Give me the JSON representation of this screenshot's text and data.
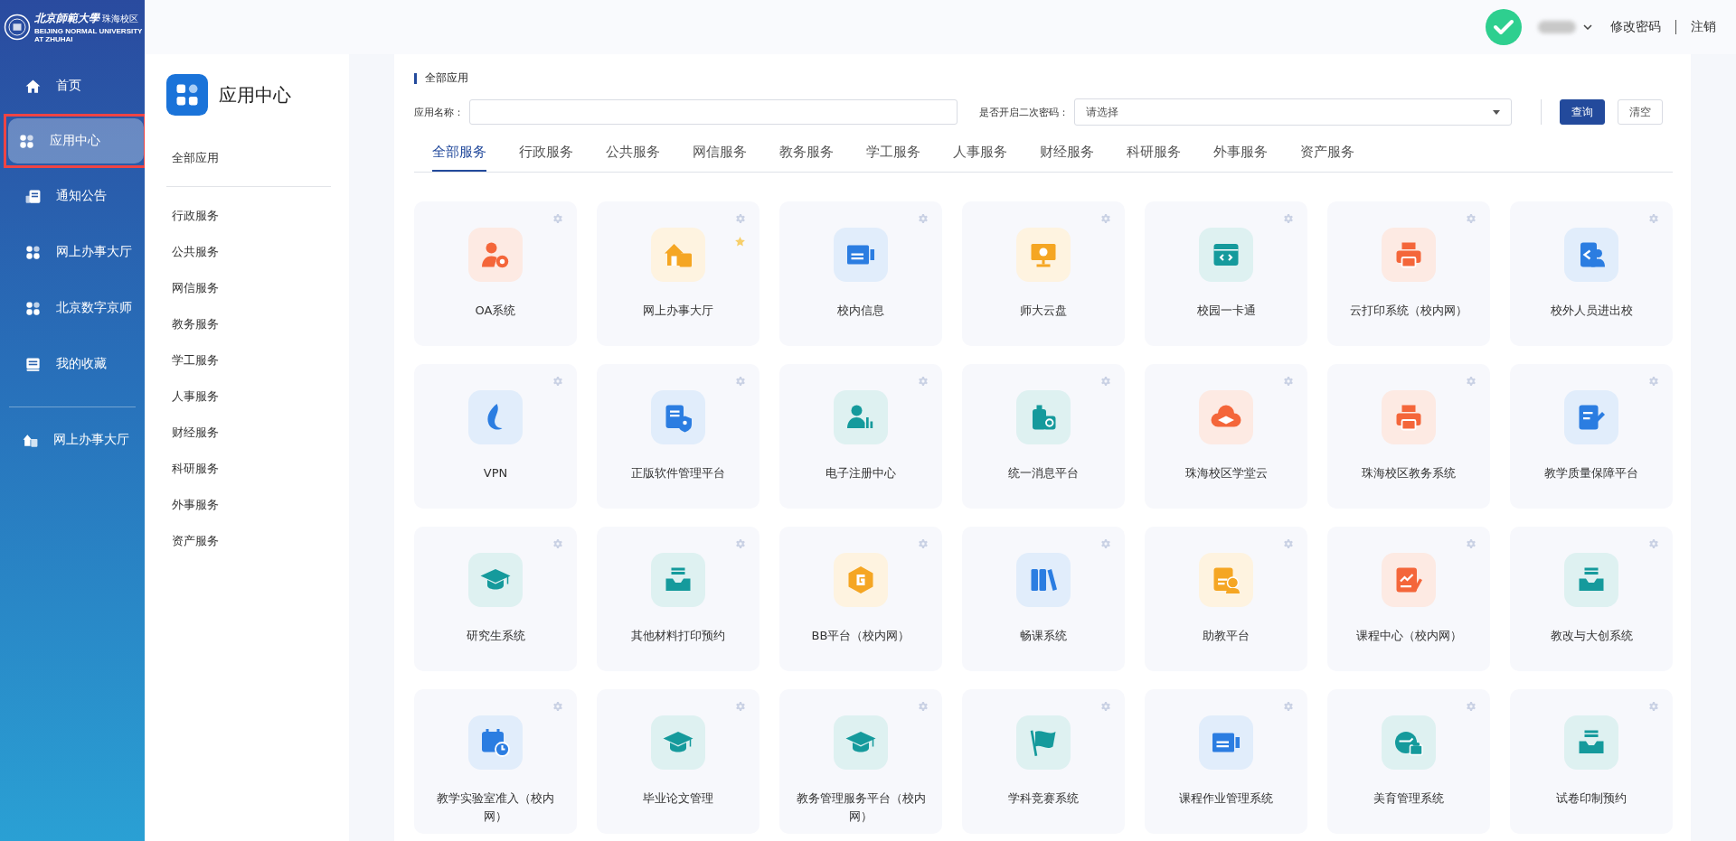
{
  "logo": {
    "name": "北京師範大學",
    "campus": "珠海校区",
    "english": "BEIJING NORMAL UNIVERSITY AT ZHUHAI"
  },
  "nav": [
    {
      "label": "首页",
      "selected": false,
      "highlighted": false
    },
    {
      "label": "应用中心",
      "selected": true,
      "highlighted": true
    },
    {
      "label": "通知公告",
      "selected": false,
      "highlighted": false
    },
    {
      "label": "网上办事大厅",
      "selected": false,
      "highlighted": false
    },
    {
      "label": "北京数字京师",
      "selected": false,
      "highlighted": false
    },
    {
      "label": "我的收藏",
      "selected": false,
      "highlighted": false
    }
  ],
  "nav_extra": [
    {
      "label": "网上办事大厅"
    }
  ],
  "header": {
    "links": [
      "修改密码",
      "注销"
    ]
  },
  "panel": {
    "title": "应用中心",
    "all": "全部应用",
    "categories": [
      "行政服务",
      "公共服务",
      "网信服务",
      "教务服务",
      "学工服务",
      "人事服务",
      "财经服务",
      "科研服务",
      "外事服务",
      "资产服务"
    ]
  },
  "main": {
    "title": "全部应用",
    "filters": [
      {
        "label": "应用名称：",
        "kind": "text"
      },
      {
        "label": "是否开启二次密码：",
        "kind": "select",
        "placeholder": "请选择"
      }
    ],
    "buttons": [
      {
        "label": "查询",
        "kind": "primary"
      },
      {
        "label": "清空",
        "kind": "plain"
      }
    ],
    "tabs": [
      {
        "label": "全部服务",
        "selected": true
      },
      {
        "label": "行政服务",
        "selected": false
      },
      {
        "label": "公共服务",
        "selected": false
      },
      {
        "label": "网信服务",
        "selected": false
      },
      {
        "label": "教务服务",
        "selected": false
      },
      {
        "label": "学工服务",
        "selected": false
      },
      {
        "label": "人事服务",
        "selected": false
      },
      {
        "label": "财经服务",
        "selected": false
      },
      {
        "label": "科研服务",
        "selected": false
      },
      {
        "label": "外事服务",
        "selected": false
      },
      {
        "label": "资产服务",
        "selected": false
      }
    ],
    "apps": [
      {
        "name": "OA系统",
        "color": "#f4663a",
        "starred": false
      },
      {
        "name": "网上办事大厅",
        "color": "#f5a623",
        "starred": true
      },
      {
        "name": "校内信息",
        "color": "#2b7de1",
        "starred": false
      },
      {
        "name": "师大云盘",
        "color": "#f5a623",
        "starred": false
      },
      {
        "name": "校园一卡通",
        "color": "#159a9c",
        "starred": false
      },
      {
        "name": "云打印系统（校内网）",
        "color": "#f4663a",
        "starred": false
      },
      {
        "name": "校外人员进出校",
        "color": "#2b7de1",
        "starred": false
      },
      {
        "name": "VPN",
        "color": "#2b7de1",
        "starred": false
      },
      {
        "name": "正版软件管理平台",
        "color": "#2b7de1",
        "starred": false
      },
      {
        "name": "电子注册中心",
        "color": "#159a9c",
        "starred": false
      },
      {
        "name": "统一消息平台",
        "color": "#159a9c",
        "starred": false
      },
      {
        "name": "珠海校区学堂云",
        "color": "#f4663a",
        "starred": false
      },
      {
        "name": "珠海校区教务系统",
        "color": "#f4663a",
        "starred": false
      },
      {
        "name": "教学质量保障平台",
        "color": "#2b7de1",
        "starred": false
      },
      {
        "name": "研究生系统",
        "color": "#159a9c",
        "starred": false
      },
      {
        "name": "其他材料打印预约",
        "color": "#159a9c",
        "starred": false
      },
      {
        "name": "BB平台（校内网）",
        "color": "#f5a623",
        "starred": false
      },
      {
        "name": "畅课系统",
        "color": "#2b7de1",
        "starred": false
      },
      {
        "name": "助教平台",
        "color": "#f5a623",
        "starred": false
      },
      {
        "name": "课程中心（校内网）",
        "color": "#f4663a",
        "starred": false
      },
      {
        "name": "教改与大创系统",
        "color": "#159a9c",
        "starred": false
      },
      {
        "name": "教学实验室准入（校内网）",
        "color": "#2b7de1",
        "starred": false
      },
      {
        "name": "毕业论文管理",
        "color": "#159a9c",
        "starred": false
      },
      {
        "name": "教务管理服务平台（校内网）",
        "color": "#159a9c",
        "starred": false
      },
      {
        "name": "学科竞赛系统",
        "color": "#159a9c",
        "starred": false
      },
      {
        "name": "课程作业管理系统",
        "color": "#2b7de1",
        "starred": false
      },
      {
        "name": "美育管理系统",
        "color": "#159a9c",
        "starred": false
      },
      {
        "name": "试卷印制预约",
        "color": "#159a9c",
        "starred": false
      }
    ]
  }
}
